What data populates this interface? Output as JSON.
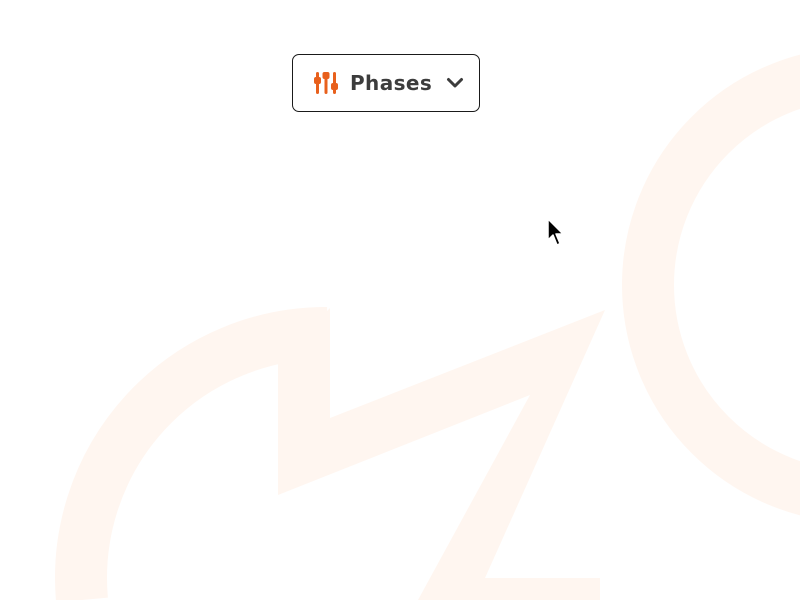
{
  "filter_button": {
    "label": "Phases",
    "icon": "sliders-icon",
    "dropdown_icon": "chevron-down-icon",
    "icon_color": "#e8601c",
    "text_color": "#3c3c3c",
    "border_color": "#1a1a1a"
  },
  "background": {
    "watermark_color": "#fff6f0"
  }
}
